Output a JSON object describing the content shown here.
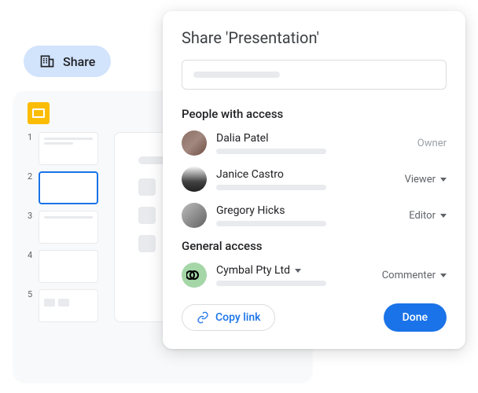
{
  "share_pill": {
    "label": "Share"
  },
  "slides": {
    "thumbnails": [
      1,
      2,
      3,
      4,
      5
    ],
    "active_index": 2
  },
  "dialog": {
    "title": "Share 'Presentation'",
    "sections": {
      "people_heading": "People with access",
      "general_heading": "General access"
    },
    "people": [
      {
        "name": "Dalia Patel",
        "role": "Owner",
        "role_editable": false
      },
      {
        "name": "Janice Castro",
        "role": "Viewer",
        "role_editable": true
      },
      {
        "name": "Gregory Hicks",
        "role": "Editor",
        "role_editable": true
      }
    ],
    "general": {
      "org_name": "Cymbal Pty Ltd",
      "role": "Commenter"
    },
    "copy_link": "Copy link",
    "done": "Done"
  }
}
